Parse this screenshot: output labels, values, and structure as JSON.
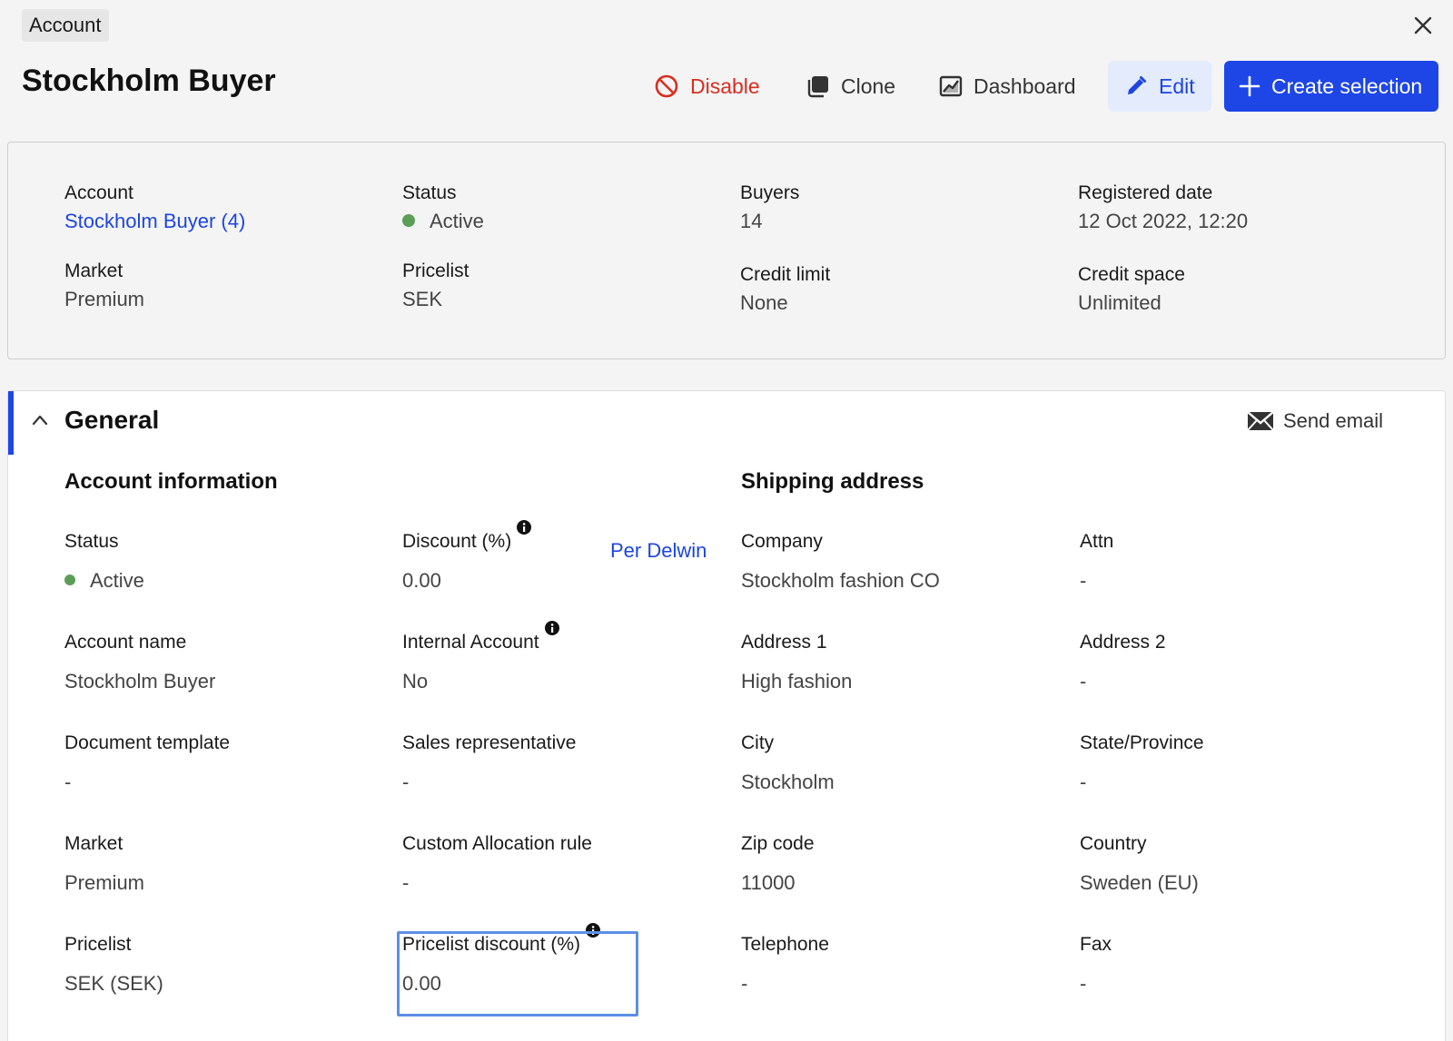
{
  "header": {
    "tag": "Account",
    "title": "Stockholm Buyer"
  },
  "toolbar": {
    "disable_label": "Disable",
    "clone_label": "Clone",
    "dashboard_label": "Dashboard",
    "edit_label": "Edit",
    "create_label": "Create selection"
  },
  "colors": {
    "accent": "#1e46e6",
    "danger": "#d92d20",
    "status_active": "#5b9e56"
  },
  "summary": {
    "account": {
      "label": "Account",
      "value": "Stockholm Buyer (4)"
    },
    "status": {
      "label": "Status",
      "value": "Active"
    },
    "buyers": {
      "label": "Buyers",
      "value": "14"
    },
    "registered": {
      "label": "Registered date",
      "value": "12 Oct 2022, 12:20"
    },
    "market": {
      "label": "Market",
      "value": "Premium"
    },
    "pricelist": {
      "label": "Pricelist",
      "value": "SEK"
    },
    "credit_limit": {
      "label": "Credit limit",
      "value": "None"
    },
    "credit_space": {
      "label": "Credit space",
      "value": "Unlimited"
    }
  },
  "general": {
    "title": "General",
    "send_email": "Send email",
    "account_info_title": "Account information",
    "shipping_title": "Shipping address",
    "per_delwin": "Per Delwin",
    "fields": {
      "status": {
        "label": "Status",
        "value": "Active"
      },
      "discount": {
        "label": "Discount (%)",
        "value": "0.00"
      },
      "company": {
        "label": "Company",
        "value": "Stockholm fashion CO"
      },
      "attn": {
        "label": "Attn",
        "value": "-"
      },
      "account_name": {
        "label": "Account name",
        "value": "Stockholm Buyer"
      },
      "internal_account": {
        "label": "Internal Account",
        "value": "No"
      },
      "address1": {
        "label": "Address 1",
        "value": "High fashion"
      },
      "address2": {
        "label": "Address 2",
        "value": "-"
      },
      "doc_template": {
        "label": "Document template",
        "value": "-"
      },
      "sales_rep": {
        "label": "Sales representative",
        "value": "-"
      },
      "city": {
        "label": "City",
        "value": "Stockholm"
      },
      "state": {
        "label": "State/Province",
        "value": "-"
      },
      "market": {
        "label": "Market",
        "value": "Premium"
      },
      "custom_alloc": {
        "label": "Custom Allocation rule",
        "value": "-"
      },
      "zip": {
        "label": "Zip code",
        "value": "11000"
      },
      "country": {
        "label": "Country",
        "value": "Sweden (EU)"
      },
      "pricelist": {
        "label": "Pricelist",
        "value": "SEK (SEK)"
      },
      "pricelist_discount": {
        "label": "Pricelist discount (%)",
        "value": "0.00"
      },
      "telephone": {
        "label": "Telephone",
        "value": "-"
      },
      "fax": {
        "label": "Fax",
        "value": "-"
      }
    }
  }
}
